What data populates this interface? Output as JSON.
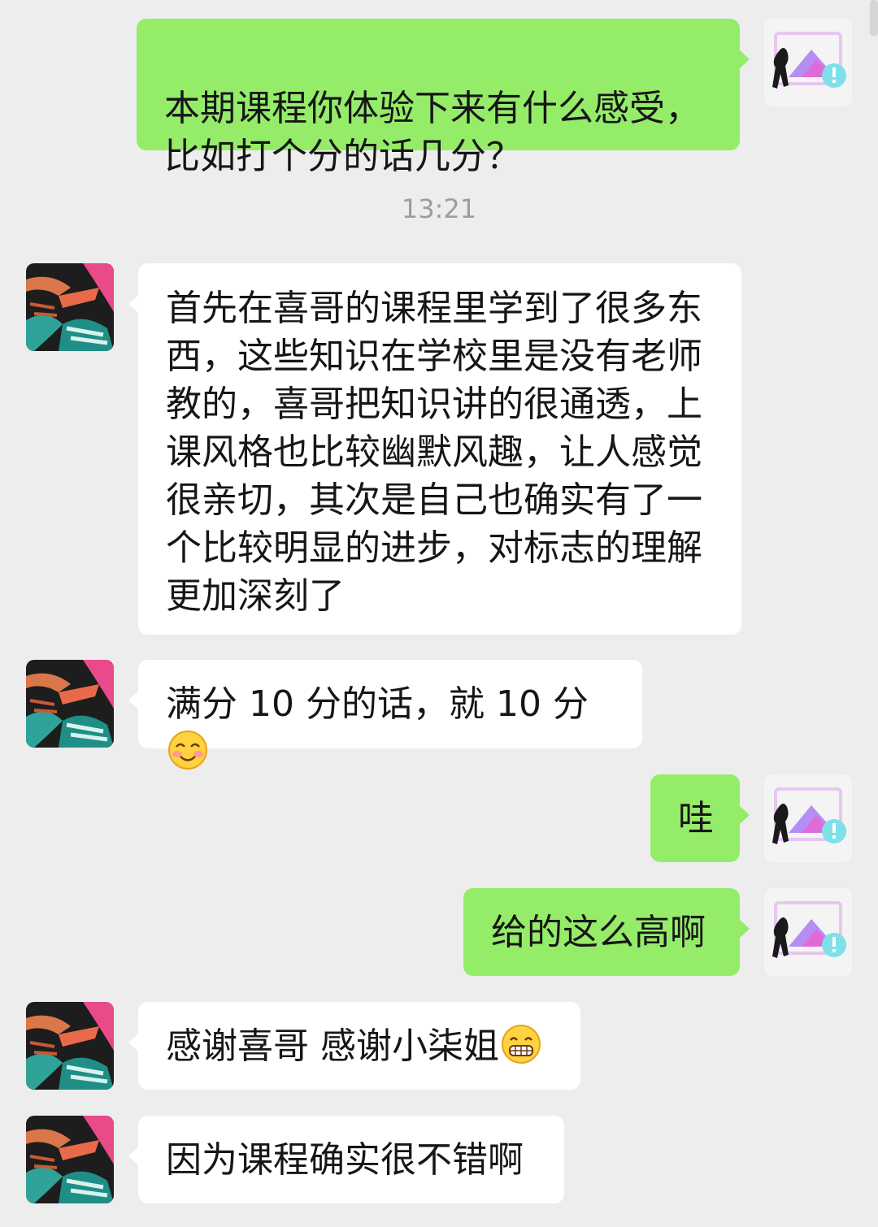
{
  "timestamp": "13:21",
  "messages": [
    {
      "sender": "me",
      "text": "本期课程你体验下来有什么感受，\n比如打个分的话几分？"
    },
    {
      "sender": "other",
      "text": "首先在喜哥的课程里学到了很多东西，这些知识在学校里是没有老师教的，喜哥把知识讲的很通透，上课风格也比较幽默风趣，让人感觉很亲切，其次是自己也确实有了一个比较明显的进步，对标志的理解更加深刻了"
    },
    {
      "sender": "other",
      "text": "满分 10 分的话，就 10 分",
      "emoji": "smiling-blush-emoji"
    },
    {
      "sender": "me",
      "text": "哇"
    },
    {
      "sender": "me",
      "text": "给的这么高啊"
    },
    {
      "sender": "other",
      "text": "感谢喜哥 感谢小柒姐",
      "emoji": "grinning-teeth-emoji"
    },
    {
      "sender": "other",
      "text": "因为课程确实很不错啊"
    }
  ],
  "avatars": {
    "me": "broken-image-avatar-icon",
    "other": "abstract-art-avatar-icon"
  },
  "colors": {
    "background": "#ededed",
    "my_bubble": "#95ec69",
    "their_bubble": "#ffffff",
    "timestamp_text": "#9d9d9d"
  }
}
